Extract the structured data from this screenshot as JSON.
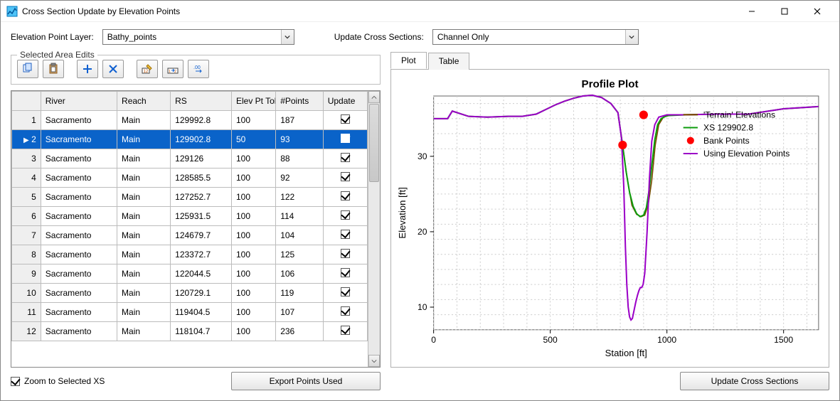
{
  "window": {
    "title": "Cross Section Update by Elevation Points"
  },
  "labels": {
    "elevation_point_layer": "Elevation Point Layer:",
    "update_cross_sections": "Update Cross Sections:",
    "selected_area_edits": "Selected Area Edits",
    "zoom_to_selected": "Zoom to Selected XS"
  },
  "combos": {
    "layer_value": "Bathy_points",
    "update_value": "Channel Only"
  },
  "columns": {
    "river": "River",
    "reach": "Reach",
    "rs": "RS",
    "tol": "Elev Pt Tol (ft)",
    "points": "#Points",
    "update": "Update"
  },
  "rows": [
    {
      "n": "1",
      "river": "Sacramento",
      "reach": "Main",
      "rs": "129992.8",
      "tol": "100",
      "pts": "187",
      "sel": false
    },
    {
      "n": "2",
      "river": "Sacramento",
      "reach": "Main",
      "rs": "129902.8",
      "tol": "50",
      "pts": "93",
      "sel": true
    },
    {
      "n": "3",
      "river": "Sacramento",
      "reach": "Main",
      "rs": "129126",
      "tol": "100",
      "pts": "88",
      "sel": false
    },
    {
      "n": "4",
      "river": "Sacramento",
      "reach": "Main",
      "rs": "128585.5",
      "tol": "100",
      "pts": "92",
      "sel": false
    },
    {
      "n": "5",
      "river": "Sacramento",
      "reach": "Main",
      "rs": "127252.7",
      "tol": "100",
      "pts": "122",
      "sel": false
    },
    {
      "n": "6",
      "river": "Sacramento",
      "reach": "Main",
      "rs": "125931.5",
      "tol": "100",
      "pts": "114",
      "sel": false
    },
    {
      "n": "7",
      "river": "Sacramento",
      "reach": "Main",
      "rs": "124679.7",
      "tol": "100",
      "pts": "104",
      "sel": false
    },
    {
      "n": "8",
      "river": "Sacramento",
      "reach": "Main",
      "rs": "123372.7",
      "tol": "100",
      "pts": "125",
      "sel": false
    },
    {
      "n": "9",
      "river": "Sacramento",
      "reach": "Main",
      "rs": "122044.5",
      "tol": "100",
      "pts": "106",
      "sel": false
    },
    {
      "n": "10",
      "river": "Sacramento",
      "reach": "Main",
      "rs": "120729.1",
      "tol": "100",
      "pts": "119",
      "sel": false
    },
    {
      "n": "11",
      "river": "Sacramento",
      "reach": "Main",
      "rs": "119404.5",
      "tol": "100",
      "pts": "107",
      "sel": false
    },
    {
      "n": "12",
      "river": "Sacramento",
      "reach": "Main",
      "rs": "118104.7",
      "tol": "100",
      "pts": "236",
      "sel": false
    }
  ],
  "buttons": {
    "export": "Export Points Used",
    "update": "Update Cross Sections"
  },
  "tabs": {
    "plot": "Plot",
    "table": "Table"
  },
  "zoom_checked": true,
  "chart_data": {
    "type": "line",
    "title": "Profile Plot",
    "xlabel": "Station [ft]",
    "ylabel": "Elevation [ft]",
    "xlim": [
      0,
      1650
    ],
    "ylim": [
      7,
      38
    ],
    "xticks": [
      0,
      500,
      1000,
      1500
    ],
    "yticks": [
      10,
      20,
      30
    ],
    "legend": [
      {
        "name": "'Terrain' Elevations",
        "color": "#7a4a00",
        "style": "line"
      },
      {
        "name": "XS 129902.8",
        "color": "#0c9c0c",
        "style": "line"
      },
      {
        "name": "Bank Points",
        "color": "#ff0000",
        "style": "dot"
      },
      {
        "name": "Using Elevation Points",
        "color": "#9b00c7",
        "style": "line"
      }
    ],
    "bank_points": [
      {
        "x": 810,
        "y": 31.5
      },
      {
        "x": 900,
        "y": 35.5
      }
    ],
    "series": {
      "terrain": [
        [
          0,
          35
        ],
        [
          60,
          35
        ],
        [
          80,
          36
        ],
        [
          150,
          35.3
        ],
        [
          230,
          35.2
        ],
        [
          320,
          35.3
        ],
        [
          380,
          35.3
        ],
        [
          440,
          35.6
        ],
        [
          480,
          36.2
        ],
        [
          520,
          36.8
        ],
        [
          560,
          37.3
        ],
        [
          600,
          37.7
        ],
        [
          640,
          38
        ],
        [
          680,
          38.1
        ],
        [
          720,
          37.8
        ],
        [
          760,
          37.0
        ],
        [
          790,
          35.8
        ],
        [
          810,
          31.5
        ],
        [
          830,
          27.0
        ],
        [
          850,
          23.5
        ],
        [
          870,
          22.3
        ],
        [
          890,
          22.0
        ],
        [
          905,
          22.2
        ],
        [
          920,
          23.6
        ],
        [
          935,
          26.8
        ],
        [
          950,
          31.5
        ],
        [
          965,
          34.2
        ],
        [
          985,
          35.2
        ],
        [
          1020,
          35.5
        ],
        [
          1080,
          35.5
        ],
        [
          1200,
          35.6
        ],
        [
          1350,
          35.6
        ],
        [
          1500,
          36.3
        ],
        [
          1650,
          36.6
        ]
      ],
      "xs": [
        [
          0,
          35
        ],
        [
          60,
          35
        ],
        [
          80,
          36
        ],
        [
          150,
          35.3
        ],
        [
          230,
          35.2
        ],
        [
          320,
          35.3
        ],
        [
          380,
          35.3
        ],
        [
          440,
          35.6
        ],
        [
          480,
          36.2
        ],
        [
          520,
          36.8
        ],
        [
          560,
          37.3
        ],
        [
          600,
          37.7
        ],
        [
          640,
          38
        ],
        [
          680,
          38.1
        ],
        [
          720,
          37.8
        ],
        [
          760,
          37.0
        ],
        [
          790,
          35.8
        ],
        [
          810,
          31.5
        ],
        [
          825,
          28.0
        ],
        [
          840,
          25.2
        ],
        [
          855,
          23.4
        ],
        [
          870,
          22.4
        ],
        [
          885,
          22.0
        ],
        [
          900,
          22.2
        ],
        [
          912,
          23.2
        ],
        [
          924,
          25.6
        ],
        [
          936,
          29.0
        ],
        [
          948,
          32.2
        ],
        [
          960,
          34.2
        ],
        [
          975,
          35.0
        ],
        [
          1000,
          35.4
        ],
        [
          1080,
          35.5
        ],
        [
          1200,
          35.6
        ],
        [
          1350,
          35.6
        ],
        [
          1500,
          36.3
        ],
        [
          1650,
          36.6
        ]
      ],
      "elevpts": [
        [
          0,
          35
        ],
        [
          60,
          35
        ],
        [
          80,
          36
        ],
        [
          150,
          35.3
        ],
        [
          230,
          35.2
        ],
        [
          320,
          35.3
        ],
        [
          380,
          35.3
        ],
        [
          440,
          35.6
        ],
        [
          480,
          36.2
        ],
        [
          520,
          36.8
        ],
        [
          560,
          37.3
        ],
        [
          600,
          37.7
        ],
        [
          640,
          38
        ],
        [
          680,
          38.1
        ],
        [
          720,
          37.8
        ],
        [
          760,
          37.0
        ],
        [
          790,
          35.8
        ],
        [
          805,
          32.5
        ],
        [
          815,
          26.0
        ],
        [
          822,
          18.0
        ],
        [
          828,
          13.0
        ],
        [
          834,
          10.0
        ],
        [
          840,
          8.7
        ],
        [
          846,
          8.3
        ],
        [
          852,
          8.5
        ],
        [
          858,
          9.4
        ],
        [
          866,
          10.6
        ],
        [
          874,
          11.6
        ],
        [
          880,
          12.2
        ],
        [
          886,
          12.6
        ],
        [
          892,
          12.6
        ],
        [
          898,
          13.0
        ],
        [
          905,
          14.5
        ],
        [
          915,
          20.0
        ],
        [
          925,
          27.0
        ],
        [
          935,
          32.0
        ],
        [
          948,
          34.2
        ],
        [
          965,
          35.2
        ],
        [
          1000,
          35.5
        ],
        [
          1080,
          35.5
        ],
        [
          1200,
          35.6
        ],
        [
          1350,
          35.6
        ],
        [
          1500,
          36.3
        ],
        [
          1650,
          36.6
        ]
      ]
    }
  }
}
